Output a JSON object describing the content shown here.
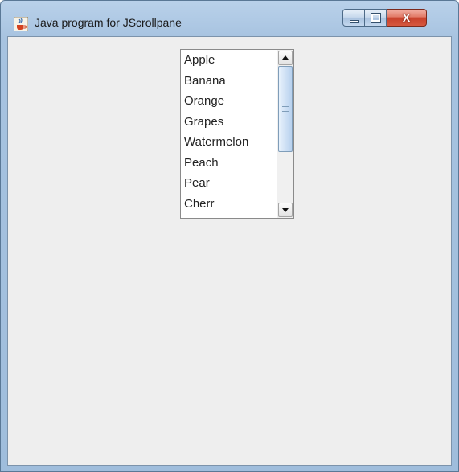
{
  "window": {
    "title": "Java program for JScrollpane",
    "controls": {
      "close_label": "X"
    }
  },
  "icons": {
    "app": "java-cup-icon",
    "minimize": "minimize-icon",
    "maximize": "maximize-icon",
    "close": "close-icon",
    "scroll_up": "arrow-up-icon",
    "scroll_down": "arrow-down-icon"
  },
  "list": {
    "items": [
      "Apple",
      "Banana",
      "Orange",
      "Grapes",
      "Watermelon",
      "Peach",
      "Pear",
      "Cherr"
    ]
  },
  "colors": {
    "client_background": "#eeeeee",
    "scroll_thumb": "#cfe1f5",
    "close_button": "#c8412c"
  }
}
